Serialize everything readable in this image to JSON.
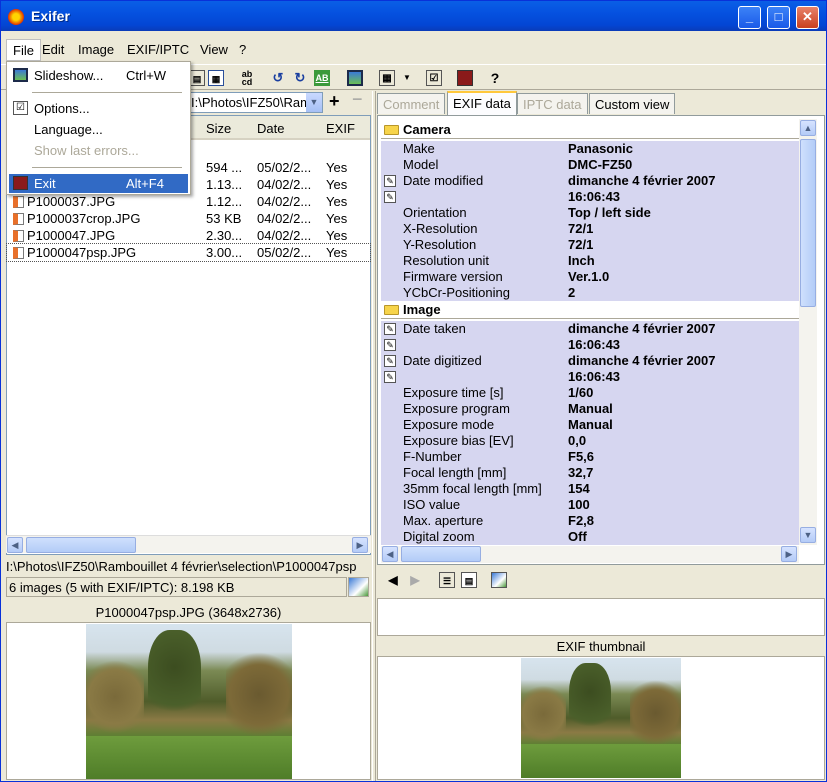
{
  "window": {
    "title": "Exifer"
  },
  "menubar": [
    "File",
    "Edit",
    "Image",
    "EXIF/IPTC",
    "View",
    "?"
  ],
  "file_menu": [
    {
      "label": "Slideshow...",
      "shortcut": "Ctrl+W",
      "icon": "slideshow-icon",
      "disabled": false
    },
    {
      "label": "Options...",
      "shortcut": "",
      "icon": "options-icon",
      "disabled": false
    },
    {
      "label": "Language...",
      "shortcut": "",
      "icon": "",
      "disabled": false
    },
    {
      "label": "Show last errors...",
      "shortcut": "",
      "icon": "",
      "disabled": true
    },
    {
      "label": "Exit",
      "shortcut": "Alt+F4",
      "icon": "exit-icon",
      "disabled": false,
      "selected": true
    }
  ],
  "left": {
    "path": "I:\\Photos\\IFZ50\\Ram",
    "columns": [
      "Size",
      "Date",
      "EXIF"
    ],
    "files": [
      {
        "name": "",
        "size": "594 ...",
        "date": "05/02/2...",
        "exif": "Yes"
      },
      {
        "name": "",
        "size": "1.13...",
        "date": "04/02/2...",
        "exif": "Yes"
      },
      {
        "name": "P1000037.JPG",
        "size": "1.12...",
        "date": "04/02/2...",
        "exif": "Yes"
      },
      {
        "name": "P1000037crop.JPG",
        "size": "53 KB",
        "date": "04/02/2...",
        "exif": "Yes"
      },
      {
        "name": "P1000047.JPG",
        "size": "2.30...",
        "date": "04/02/2...",
        "exif": "Yes"
      },
      {
        "name": "P1000047psp.JPG",
        "size": "3.00...",
        "date": "05/02/2...",
        "exif": "Yes"
      }
    ],
    "full_path": "I:\\Photos\\IFZ50\\Rambouillet 4 février\\selection\\P1000047psp",
    "count": "6 images (5 with EXIF/IPTC): 8.198 KB",
    "preview_caption": "P1000047psp.JPG (3648x2736)"
  },
  "right": {
    "tabs": [
      {
        "label": "Comment",
        "state": "disabled"
      },
      {
        "label": "EXIF data",
        "state": "active"
      },
      {
        "label": "IPTC data",
        "state": "disabled"
      },
      {
        "label": "Custom view",
        "state": "normal"
      }
    ],
    "sections": [
      {
        "title": "Camera",
        "rows": [
          {
            "key": "Make",
            "value": "Panasonic",
            "editable": false
          },
          {
            "key": "Model",
            "value": "DMC-FZ50",
            "editable": false
          },
          {
            "key": "Date modified",
            "value": "dimanche 4 février 2007",
            "editable": true
          },
          {
            "key": "",
            "value": "16:06:43",
            "editable": true
          },
          {
            "key": "Orientation",
            "value": "Top / left side",
            "editable": false
          },
          {
            "key": "X-Resolution",
            "value": "72/1",
            "editable": false
          },
          {
            "key": "Y-Resolution",
            "value": "72/1",
            "editable": false
          },
          {
            "key": "Resolution unit",
            "value": "Inch",
            "editable": false
          },
          {
            "key": "Firmware version",
            "value": "Ver.1.0",
            "editable": false
          },
          {
            "key": "YCbCr-Positioning",
            "value": "2",
            "editable": false
          }
        ]
      },
      {
        "title": "Image",
        "rows": [
          {
            "key": "Date taken",
            "value": "dimanche 4 février 2007",
            "editable": true
          },
          {
            "key": "",
            "value": "16:06:43",
            "editable": true
          },
          {
            "key": "Date digitized",
            "value": "dimanche 4 février 2007",
            "editable": true
          },
          {
            "key": "",
            "value": "16:06:43",
            "editable": true
          },
          {
            "key": "Exposure time [s]",
            "value": "1/60",
            "editable": false
          },
          {
            "key": "Exposure program",
            "value": "Manual",
            "editable": false
          },
          {
            "key": "Exposure mode",
            "value": "Manual",
            "editable": false
          },
          {
            "key": "Exposure bias [EV]",
            "value": "0,0",
            "editable": false
          },
          {
            "key": "F-Number",
            "value": "F5,6",
            "editable": false
          },
          {
            "key": "Focal length [mm]",
            "value": "32,7",
            "editable": false
          },
          {
            "key": "35mm focal length [mm]",
            "value": "154",
            "editable": false
          },
          {
            "key": "ISO value",
            "value": "100",
            "editable": false
          },
          {
            "key": "Max. aperture",
            "value": "F2,8",
            "editable": false
          },
          {
            "key": "Digital zoom",
            "value": "Off",
            "editable": false
          }
        ]
      }
    ],
    "thumb_caption": "EXIF thumbnail"
  },
  "colors": {
    "title_bar": "#0551e0",
    "selection": "#316ac5",
    "exif_row": "#d6d6f0",
    "tab_highlight": "#ffc83c"
  }
}
